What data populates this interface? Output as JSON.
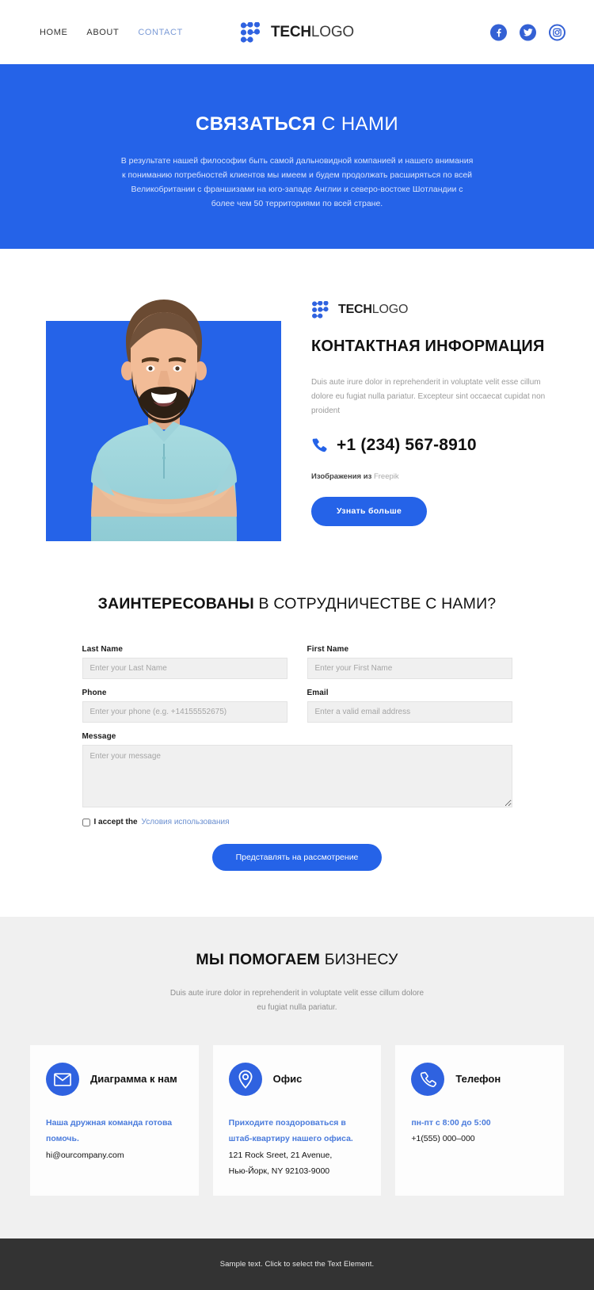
{
  "header": {
    "nav": [
      {
        "label": "HOME",
        "active": false
      },
      {
        "label": "ABOUT",
        "active": false
      },
      {
        "label": "CONTACT",
        "active": true
      }
    ],
    "logo": {
      "bold": "TECH",
      "light": "LOGO",
      "mark": "dots-grid-icon"
    },
    "socials": [
      {
        "name": "facebook-icon"
      },
      {
        "name": "twitter-icon"
      },
      {
        "name": "instagram-icon"
      }
    ]
  },
  "hero": {
    "title_strong": "СВЯЗАТЬСЯ",
    "title_light": " С НАМИ",
    "paragraph": "В результате нашей философии быть самой дальновидной компанией и нашего внимания к пониманию потребностей клиентов мы имеем и будем продолжать расширяться по всей Великобритании с франшизами на юго-западе Англии и северо-востоке Шотландии с более чем 50 территориями по всей стране.",
    "bg_color": "#2563E8"
  },
  "contact": {
    "photo_alt": "smiling-bearded-man-crossed-arms",
    "photo_bg": "#2563E8",
    "logo": {
      "bold": "TECH",
      "light": "LOGO"
    },
    "title": "КОНТАКТНАЯ ИНФОРМАЦИЯ",
    "description": "Duis aute irure dolor in reprehenderit in voluptate velit esse cillum dolore eu fugiat nulla pariatur. Excepteur sint occaecat cupidat non proident",
    "phone": "+1 (234) 567-8910",
    "phone_icon": "phone-icon",
    "credit_prefix": "Изображения из",
    "credit_link": "Freepik",
    "button_label": "Узнать больше"
  },
  "form": {
    "heading_strong": "ЗАИНТЕРЕСОВАНЫ",
    "heading_light": " В СОТРУДНИЧЕСТВЕ С НАМИ?",
    "fields": {
      "last_name": {
        "label": "Last Name",
        "placeholder": "Enter your Last Name",
        "value": ""
      },
      "first_name": {
        "label": "First Name",
        "placeholder": "Enter your First Name",
        "value": ""
      },
      "phone": {
        "label": "Phone",
        "placeholder": "Enter your phone (e.g. +14155552675)",
        "value": ""
      },
      "email": {
        "label": "Email",
        "placeholder": "Enter a valid email address",
        "value": ""
      },
      "message": {
        "label": "Message",
        "placeholder": "Enter your message",
        "value": ""
      }
    },
    "accept_text": "I accept the",
    "accept_link": "Условия использования",
    "submit_label": "Представлять на рассмотрение"
  },
  "help": {
    "heading_strong": "МЫ ПОМОГАЕМ",
    "heading_light": " БИЗНЕСУ",
    "subtitle": "Duis aute irure dolor in reprehenderit in voluptate velit esse cillum dolore eu fugiat nulla pariatur.",
    "cards": [
      {
        "icon": "envelope-icon",
        "title": "Диаграмма к нам",
        "accent_line": "Наша дружная команда готова помочь.",
        "plain_line": "hi@ourcompany.com"
      },
      {
        "icon": "map-pin-icon",
        "title": "Офис",
        "accent_line": "Приходите поздороваться в штаб-квартиру нашего офиса.",
        "plain_line": "121 Rock Sreet, 21 Avenue,",
        "plain_line2": "Нью-Йорк, NY 92103-9000"
      },
      {
        "icon": "phone-handset-icon",
        "title": "Телефон",
        "accent_line": "пн-пт с 8:00 до 5:00",
        "plain_line": "+1(555) 000–000"
      }
    ]
  },
  "footer": {
    "text": "Sample text. Click to select the Text Element.",
    "bg_color": "#333333"
  },
  "colors": {
    "brand_blue": "#2563E8",
    "icon_blue": "#3461D4",
    "accent_link": "#4A7BDC",
    "section_gray": "#F0F0F0"
  }
}
